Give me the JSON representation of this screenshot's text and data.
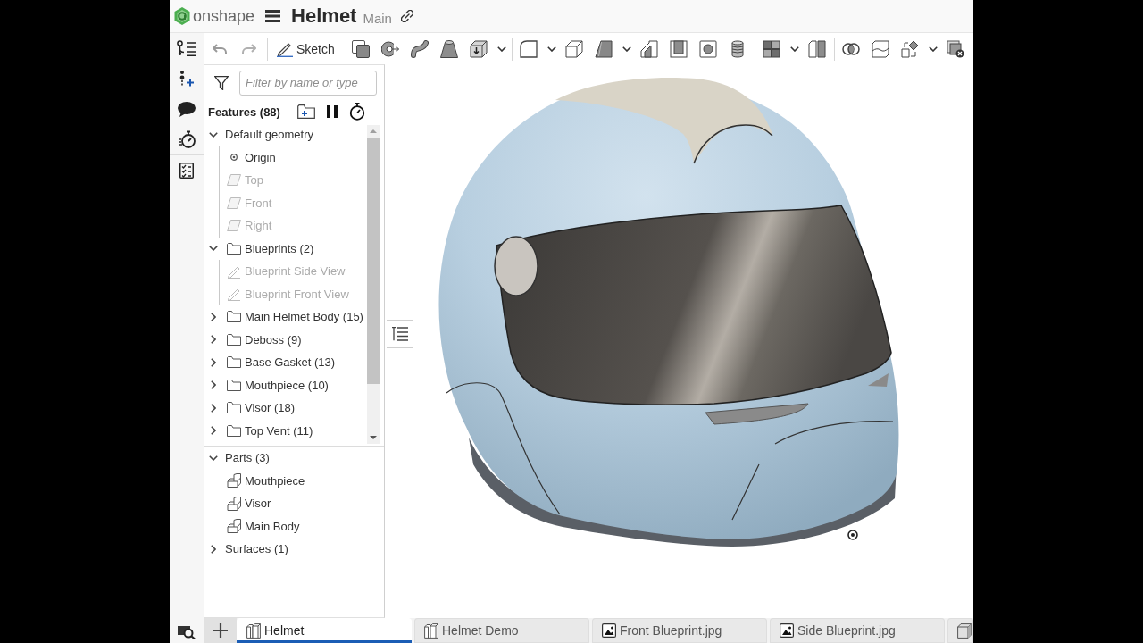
{
  "header": {
    "logo_text": "onshape",
    "document_title": "Helmet",
    "workspace": "Main"
  },
  "toolbar": {
    "sketch_label": "Sketch"
  },
  "features": {
    "filter": {
      "placeholder": "Filter by name or type"
    },
    "title": "Features (88)",
    "tree": [
      {
        "kind": "group",
        "label": "Default geometry",
        "expanded": true,
        "children": [
          {
            "kind": "origin",
            "label": "Origin",
            "hidden": false
          },
          {
            "kind": "plane",
            "label": "Top",
            "hidden": true
          },
          {
            "kind": "plane",
            "label": "Front",
            "hidden": true
          },
          {
            "kind": "plane",
            "label": "Right",
            "hidden": true
          }
        ]
      },
      {
        "kind": "folder",
        "label": "Blueprints (2)",
        "expanded": true,
        "children": [
          {
            "kind": "sketch",
            "label": "Blueprint Side View",
            "hidden": true
          },
          {
            "kind": "sketch",
            "label": "Blueprint Front View",
            "hidden": true
          }
        ]
      },
      {
        "kind": "folder",
        "label": "Main Helmet Body (15)",
        "expanded": false
      },
      {
        "kind": "folder",
        "label": "Deboss (9)",
        "expanded": false
      },
      {
        "kind": "folder",
        "label": "Base Gasket (13)",
        "expanded": false
      },
      {
        "kind": "folder",
        "label": "Mouthpiece (10)",
        "expanded": false
      },
      {
        "kind": "folder",
        "label": "Visor (18)",
        "expanded": false
      },
      {
        "kind": "folder",
        "label": "Top Vent (11)",
        "expanded": false
      }
    ]
  },
  "parts": [
    {
      "label": "Parts (3)",
      "expanded": true,
      "children": [
        {
          "kind": "part",
          "label": "Mouthpiece",
          "hidden": false
        },
        {
          "kind": "part",
          "label": "Visor",
          "hidden": false
        },
        {
          "kind": "part",
          "label": "Main Body",
          "hidden": false
        }
      ]
    },
    {
      "label": "Surfaces (1)",
      "expanded": false
    }
  ],
  "tabs": [
    {
      "kind": "part_studio",
      "label": "Helmet",
      "selected": true
    },
    {
      "kind": "part_studio",
      "label": "Helmet Demo",
      "selected": false
    },
    {
      "kind": "image",
      "label": "Front Blueprint.jpg",
      "selected": false
    },
    {
      "kind": "image",
      "label": "Side Blueprint.jpg",
      "selected": false
    },
    {
      "kind": "model",
      "selected": false
    }
  ]
}
